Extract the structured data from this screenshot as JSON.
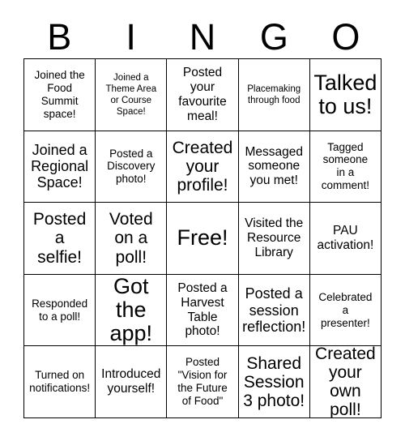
{
  "card": {
    "header_letters": [
      "B",
      "I",
      "N",
      "G",
      "O"
    ],
    "rows": [
      [
        {
          "text": "Joined the\nFood\nSummit\nspace!",
          "size": "s"
        },
        {
          "text": "Joined a\nTheme Area\nor Course\nSpace!",
          "size": "xs"
        },
        {
          "text": "Posted\nyour\nfavourite\nmeal!",
          "size": "m"
        },
        {
          "text": "Placemaking\nthrough food",
          "size": "xs"
        },
        {
          "text": "Talked\nto us!",
          "size": "xxl"
        }
      ],
      [
        {
          "text": "Joined a\nRegional\nSpace!",
          "size": "l"
        },
        {
          "text": "Posted a\nDiscovery\nphoto!",
          "size": "s"
        },
        {
          "text": "Created\nyour\nprofile!",
          "size": "xl"
        },
        {
          "text": "Messaged\nsomeone\nyou met!",
          "size": "m"
        },
        {
          "text": "Tagged\nsomeone\nin a\ncomment!",
          "size": "s"
        }
      ],
      [
        {
          "text": "Posted\na\nselfie!",
          "size": "xl"
        },
        {
          "text": "Voted\non a\npoll!",
          "size": "xl"
        },
        {
          "text": "Free!",
          "size": "xxl"
        },
        {
          "text": "Visited the\nResource\nLibrary",
          "size": "m"
        },
        {
          "text": "PAU\nactivation!",
          "size": "m"
        }
      ],
      [
        {
          "text": "Responded\nto a poll!",
          "size": "s"
        },
        {
          "text": "Got the\napp!",
          "size": "xxl"
        },
        {
          "text": "Posted a\nHarvest\nTable\nphoto!",
          "size": "m"
        },
        {
          "text": "Posted a\nsession\nreflection!",
          "size": "l"
        },
        {
          "text": "Celebrated\na\npresenter!",
          "size": "s"
        }
      ],
      [
        {
          "text": "Turned on\nnotifications!",
          "size": "s"
        },
        {
          "text": "Introduced\nyourself!",
          "size": "m"
        },
        {
          "text": "Posted\n\"Vision for\nthe Future\nof Food\"",
          "size": "s"
        },
        {
          "text": "Shared\nSession\n3 photo!",
          "size": "xl"
        },
        {
          "text": "Created\nyour\nown poll!",
          "size": "xl"
        }
      ]
    ]
  }
}
